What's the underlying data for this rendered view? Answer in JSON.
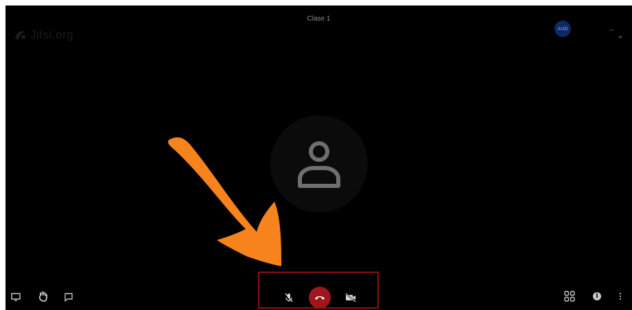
{
  "meeting": {
    "title": "Clase 1",
    "timer": "",
    "logo_text": "Jitsi.org"
  },
  "participant": {
    "avatar_initials": "AUD"
  },
  "toolbar": {
    "left": [
      "desktop-share-icon",
      "raise-hand-icon",
      "chat-icon"
    ],
    "center": [
      "mic-muted-icon",
      "hangup-icon",
      "camera-off-icon"
    ],
    "right": [
      "tile-view-icon",
      "info-icon",
      "more-options-icon"
    ],
    "info_glyph": "i"
  },
  "colors": {
    "background": "#000000",
    "hangup": "#a1151d",
    "highlight_border": "#8b1111",
    "arrow": "#f7831d",
    "avatar_small": "#0e2a63"
  }
}
